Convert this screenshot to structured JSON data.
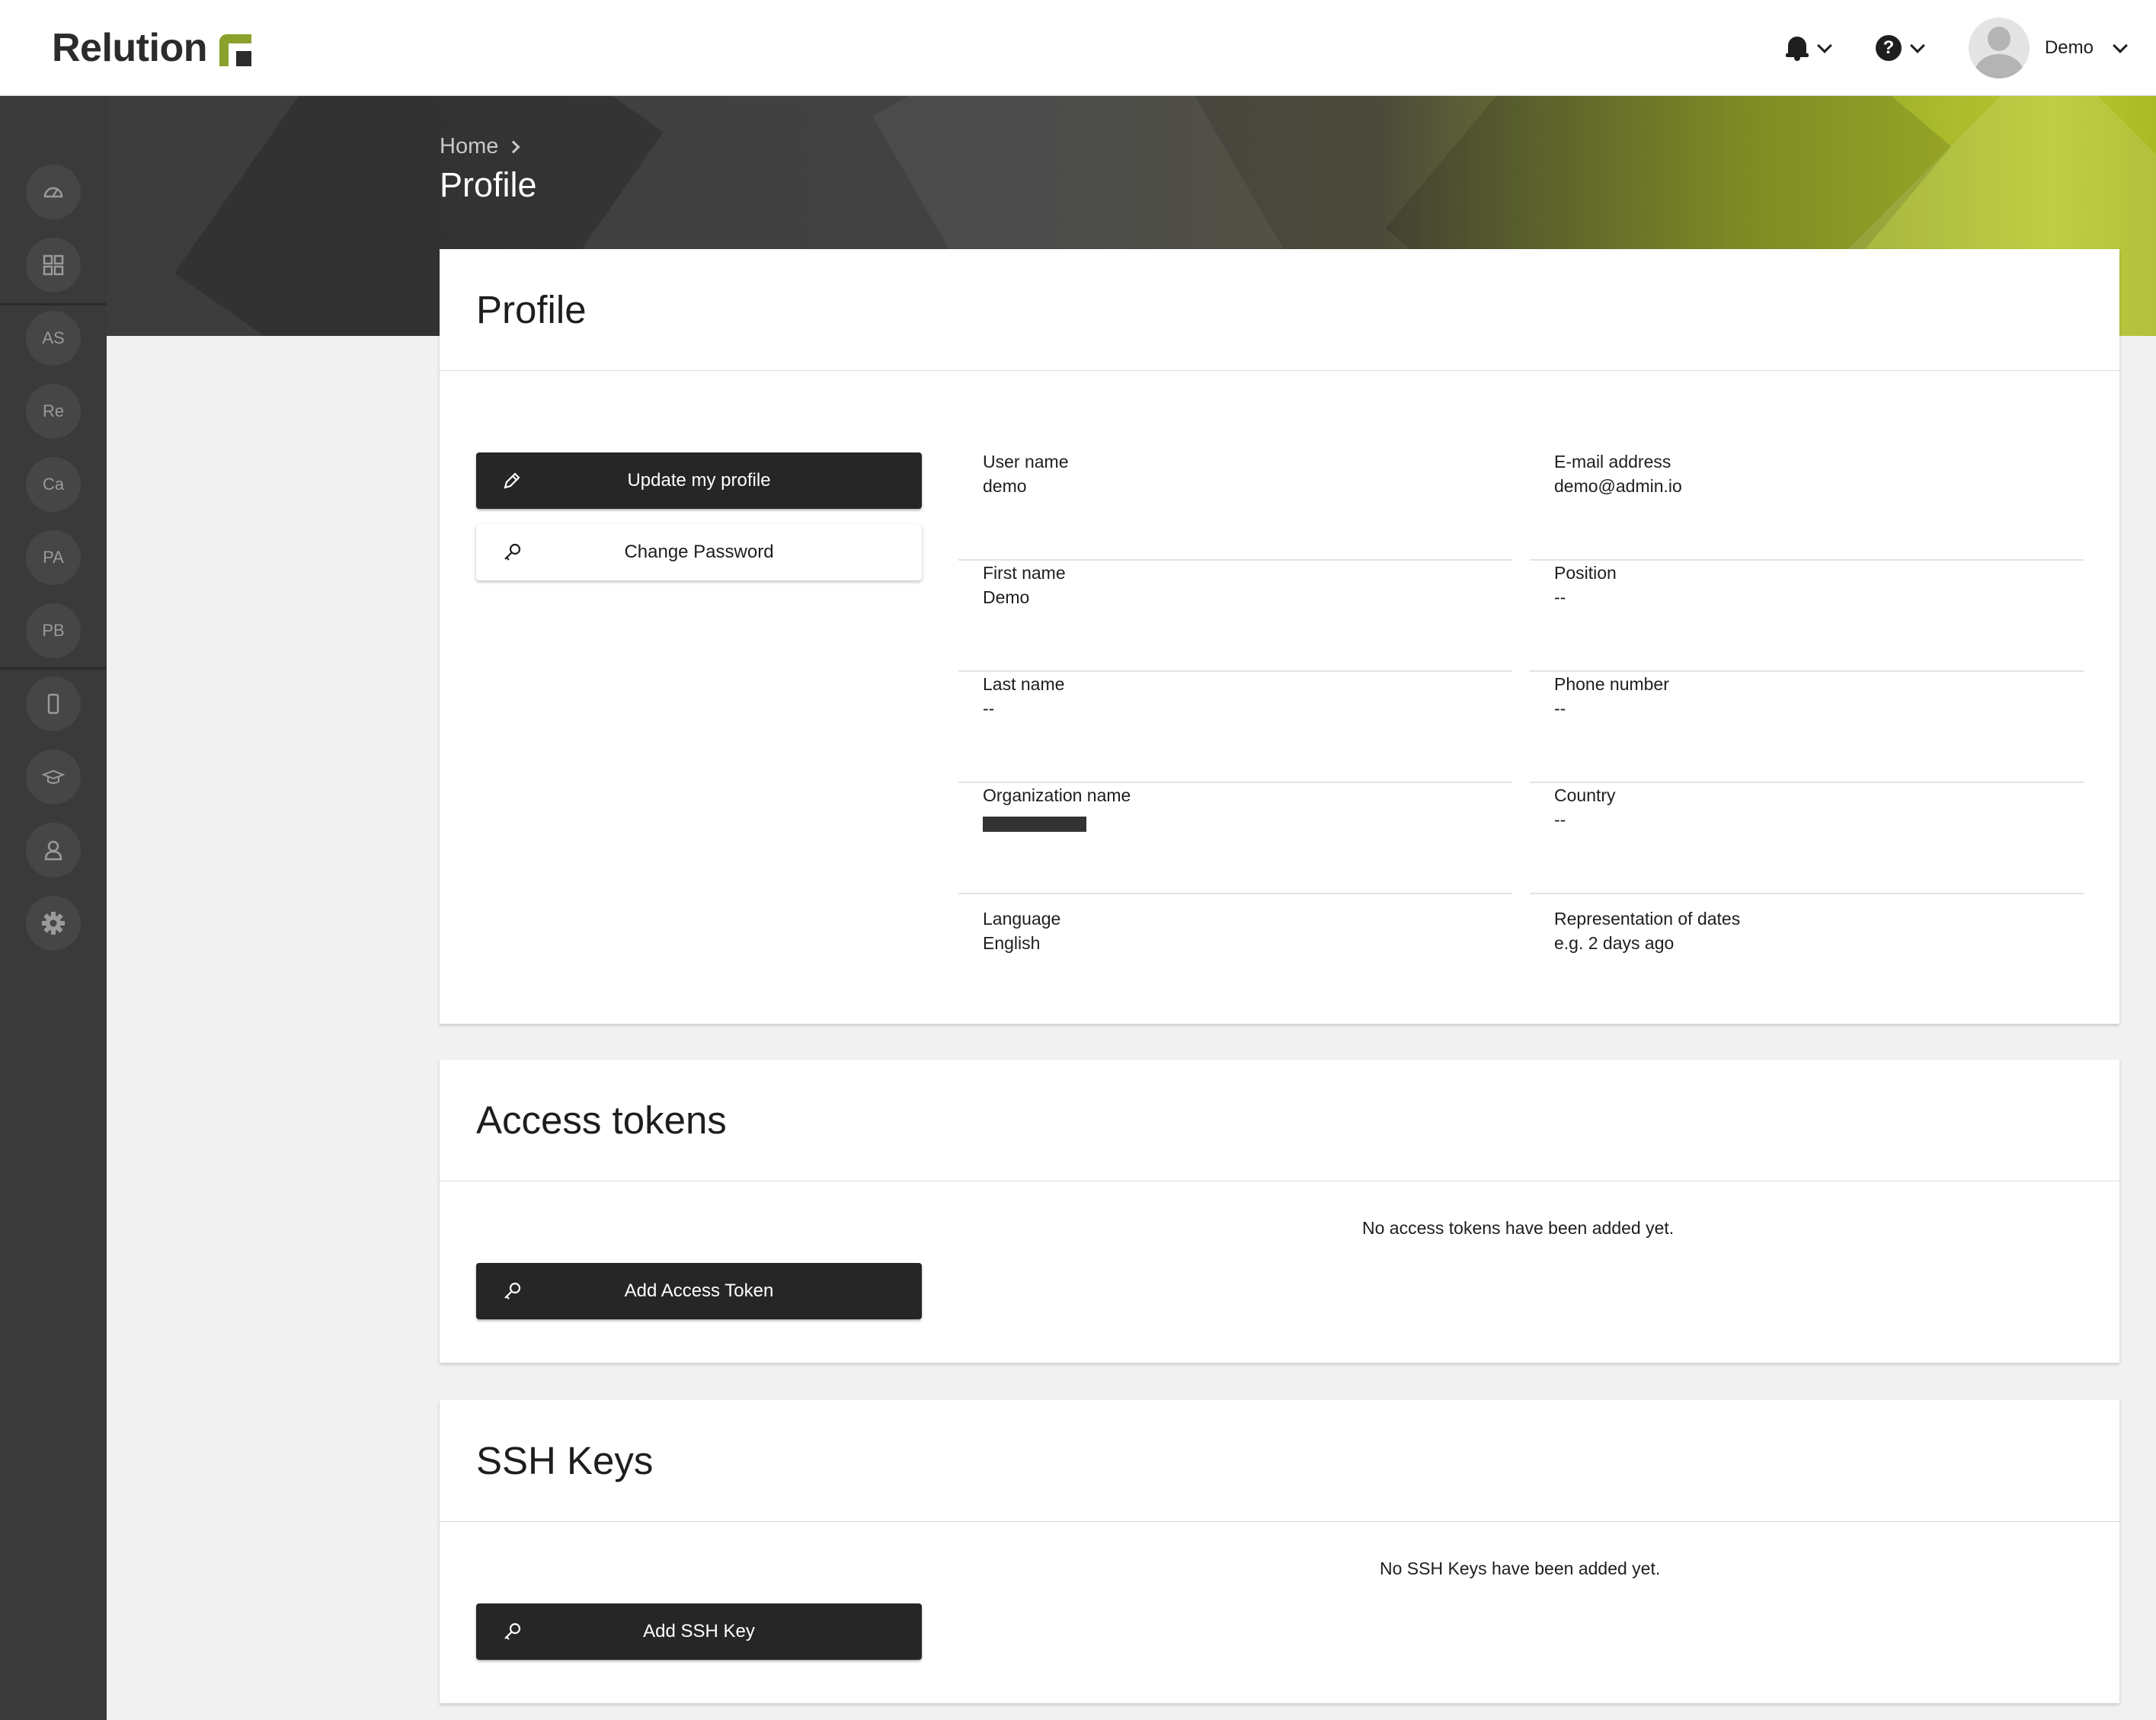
{
  "app": {
    "logo_text": "Relution"
  },
  "topbar": {
    "notifications_icon": "bell-icon",
    "help_icon": "question-circle-icon",
    "user_name": "Demo"
  },
  "sidebar": {
    "items": [
      {
        "icon": "speedometer-icon"
      },
      {
        "icon": "grid-icon"
      },
      {
        "label": "AS"
      },
      {
        "label": "Re"
      },
      {
        "label": "Ca"
      },
      {
        "label": "PA"
      },
      {
        "label": "PB"
      },
      {
        "icon": "mobile-device-icon"
      },
      {
        "icon": "graduation-cap-icon"
      },
      {
        "icon": "user-icon"
      },
      {
        "icon": "gear-icon"
      }
    ]
  },
  "breadcrumb": {
    "home": "Home",
    "current": "Profile"
  },
  "profile_card": {
    "title": "Profile",
    "update_button": "Update my profile",
    "change_password_button": "Change Password",
    "fields": {
      "user_name": {
        "label": "User name",
        "value": "demo"
      },
      "email": {
        "label": "E-mail address",
        "value": "demo@admin.io"
      },
      "first_name": {
        "label": "First name",
        "value": "Demo"
      },
      "position": {
        "label": "Position",
        "value": "--"
      },
      "last_name": {
        "label": "Last name",
        "value": "--"
      },
      "phone": {
        "label": "Phone number",
        "value": "--"
      },
      "organization": {
        "label": "Organization name",
        "value": ""
      },
      "country": {
        "label": "Country",
        "value": "--"
      },
      "language": {
        "label": "Language",
        "value": "English"
      },
      "date_repr": {
        "label": "Representation of dates",
        "value": "e.g. 2 days ago"
      }
    }
  },
  "tokens_card": {
    "title": "Access tokens",
    "empty_message": "No access tokens have been added yet.",
    "add_button": "Add Access Token"
  },
  "ssh_card": {
    "title": "SSH Keys",
    "empty_message": "No SSH Keys have been added yet.",
    "add_button": "Add SSH Key"
  },
  "colors": {
    "accent": "#8aa12b",
    "dark": "#262626",
    "sidebar": "#3a3a3a"
  }
}
